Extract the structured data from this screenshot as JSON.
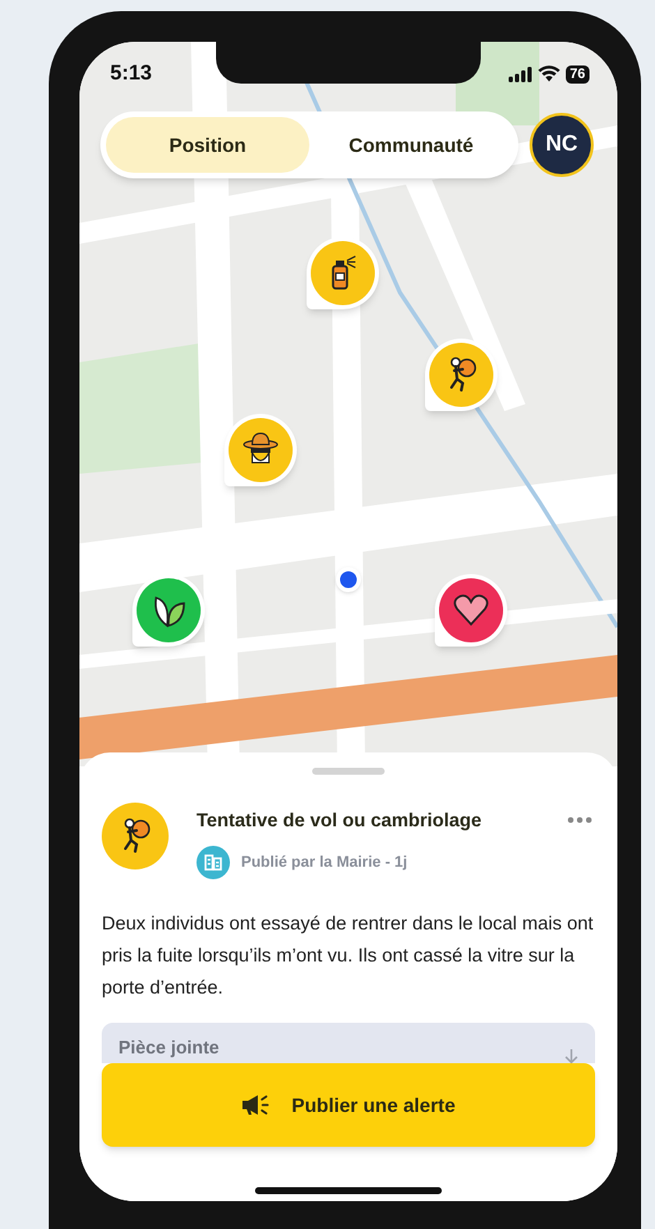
{
  "status_bar": {
    "time": "5:13",
    "battery": "76"
  },
  "tabs": [
    {
      "label": "Position",
      "selected": true
    },
    {
      "label": "Communauté",
      "selected": false
    }
  ],
  "avatar": {
    "initials": "NC"
  },
  "map": {
    "kind": "picture",
    "markers": [
      {
        "kind": "graffiti",
        "color": "#f9c514"
      },
      {
        "kind": "burglary",
        "color": "#f9c514"
      },
      {
        "kind": "suspect",
        "color": "#f9c514"
      },
      {
        "kind": "nature",
        "color": "#1fbf4c"
      },
      {
        "kind": "health",
        "color": "#ec2f58"
      }
    ]
  },
  "alert": {
    "kind": "burglary",
    "title": "Tentative de vol ou cambriolage",
    "publisher": "Publié par la Mairie - 1j",
    "description": "Deux individus ont essayé de rentrer dans le local mais ont pris la fuite lorsqu’ils m’ont vu. Ils ont cassé la vitre sur la porte d’entrée.",
    "attachment": {
      "label": "Pièce jointe"
    }
  },
  "publish_button": {
    "label": "Publier une alerte"
  }
}
